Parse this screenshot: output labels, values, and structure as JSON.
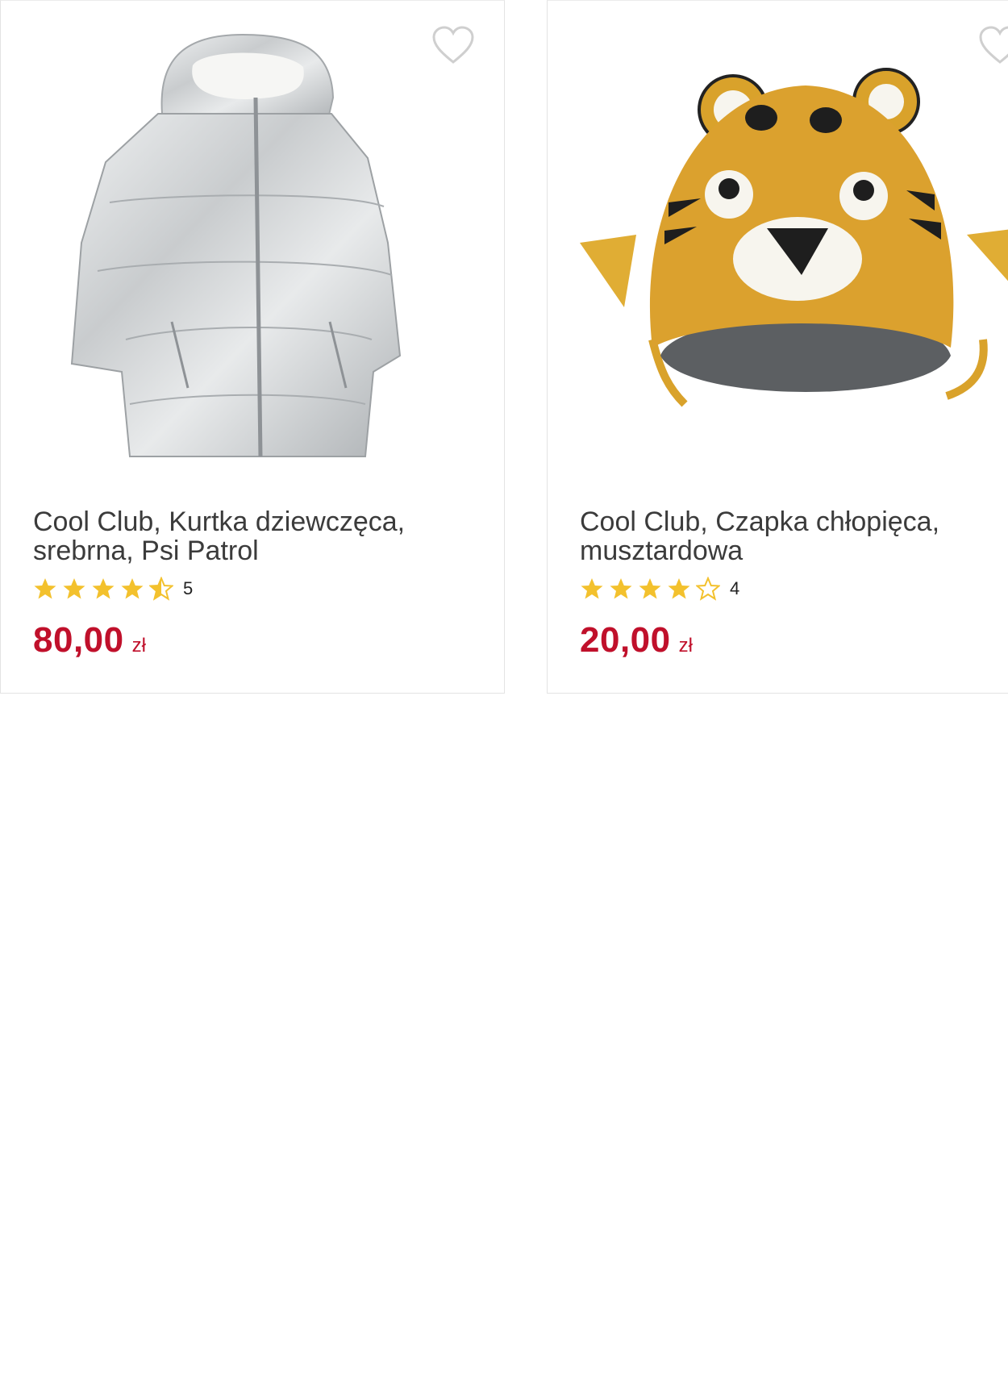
{
  "accent_color": "#c0102b",
  "star_color": "#f3c12d",
  "products": [
    {
      "title": "Cool Club, Kurtka dziewczęca, srebrna, Psi Patrol",
      "rating": 4.5,
      "rating_count": "5",
      "price": "80,00",
      "currency": "zł",
      "image": "silver-puffer-jacket",
      "wishlist_icon": "heart-outline-icon"
    },
    {
      "title": "Cool Club, Czapka chłopięca, musztardowa",
      "rating": 4,
      "rating_count": "4",
      "price": "20,00",
      "currency": "zł",
      "image": "mustard-tiger-hat",
      "wishlist_icon": "heart-outline-icon"
    }
  ]
}
